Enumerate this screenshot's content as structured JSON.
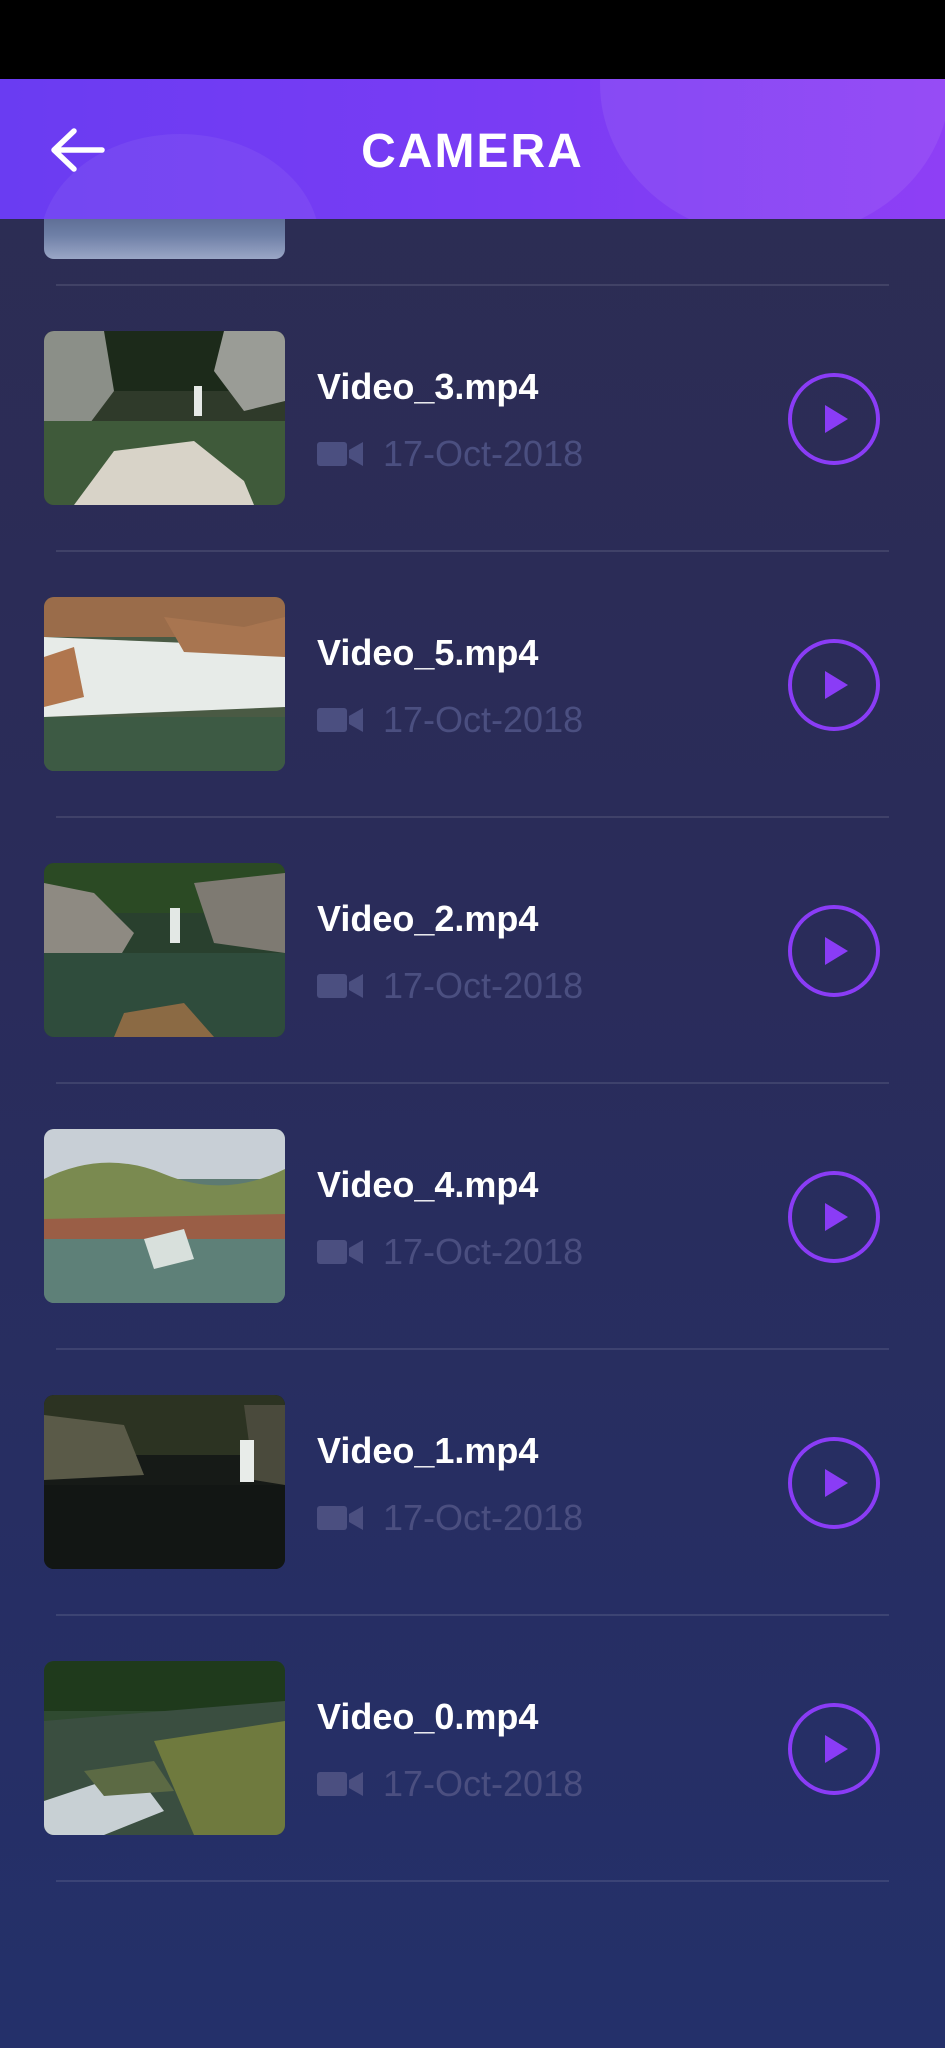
{
  "header": {
    "title": "CAMERA"
  },
  "videos": [
    {
      "title": "Video_3.mp4",
      "date": "17-Oct-2018"
    },
    {
      "title": "Video_5.mp4",
      "date": "17-Oct-2018"
    },
    {
      "title": "Video_2.mp4",
      "date": "17-Oct-2018"
    },
    {
      "title": "Video_4.mp4",
      "date": "17-Oct-2018"
    },
    {
      "title": "Video_1.mp4",
      "date": "17-Oct-2018"
    },
    {
      "title": "Video_0.mp4",
      "date": "17-Oct-2018"
    }
  ],
  "icons": {
    "back": "arrow-left-icon",
    "camera": "video-camera-icon",
    "play": "play-icon"
  },
  "colors": {
    "header_start": "#6a3cf2",
    "header_end": "#8e3ff5",
    "accent": "#8a3cf6",
    "date_text": "#4b4f80",
    "background": "#2a2c5a"
  }
}
